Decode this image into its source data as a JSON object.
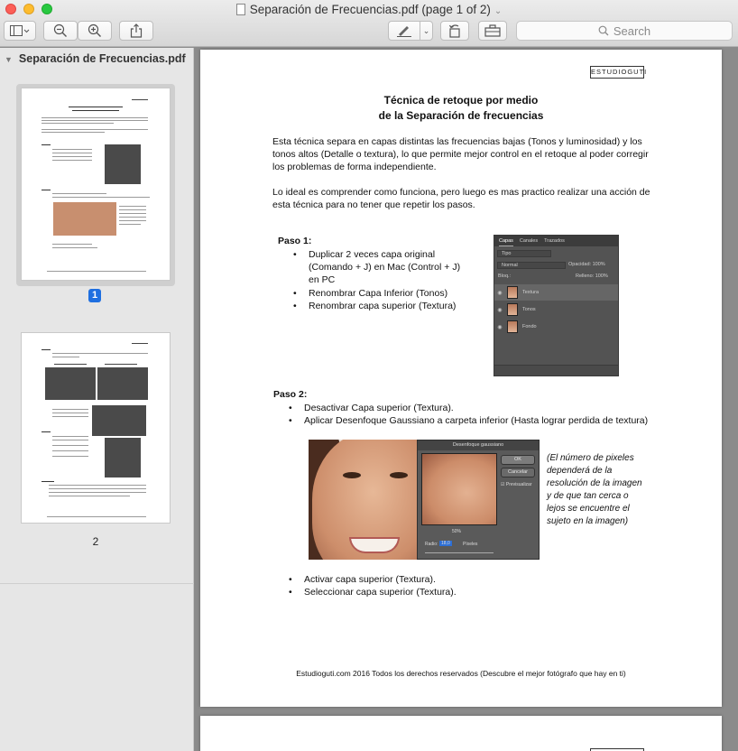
{
  "window": {
    "title": "Separación de Frecuencias.pdf (page 1 of 2)"
  },
  "toolbar": {
    "search_placeholder": "Search"
  },
  "sidebar": {
    "file_name": "Separación de Frecuencias.pdf",
    "pages": [
      {
        "number": "1",
        "selected": true
      },
      {
        "number": "2",
        "selected": false
      }
    ]
  },
  "document": {
    "logo": "ESTUDIOGUTI",
    "title_line1": "Técnica de retoque por medio",
    "title_line2": "de la Separación de frecuencias",
    "intro": "Esta técnica separa en capas distintas las frecuencias bajas (Tonos y luminosidad) y los tonos altos (Detalle o textura), lo que permite mejor control en el retoque al poder corregir los problemas de forma independiente.",
    "ideal": "Lo ideal es comprender como funciona, pero luego es mas practico realizar una acción de esta técnica para no tener que repetir los pasos.",
    "step1": {
      "label": "Paso 1:",
      "items": [
        "Duplicar 2 veces capa original (Comando + J) en Mac (Control + J) en PC",
        "Renombrar Capa Inferior (Tonos)",
        "Renombrar capa superior (Textura)"
      ]
    },
    "layers_panel": {
      "tabs": [
        "Capas",
        "Canales",
        "Trazados"
      ],
      "kind": "Tipo",
      "blend": "Normal",
      "opacity": "Opacidad: 100%",
      "lock": "Bloq.:",
      "fill": "Relleno: 100%",
      "layers": [
        "Textura",
        "Tonos",
        "Fondo"
      ]
    },
    "step2": {
      "label": "Paso 2:",
      "items": [
        "Desactivar Capa superior (Textura).",
        "Aplicar Desenfoque Gaussiano a carpeta inferior (Hasta lograr perdida de textura)"
      ]
    },
    "gauss_dialog": {
      "title": "Desenfoque gaussiano",
      "ok": "OK",
      "cancel": "Cancelar",
      "preview": "Previsualizar",
      "zoom": "50%",
      "radius_label": "Radio:",
      "radius_value": "18,0",
      "radius_unit": "Píxeles"
    },
    "caption": "(El número de pixeles dependerá de la resolución de la imagen y de que tan cerca o lejos se encuentre el sujeto en la imagen)",
    "step3_items": [
      "Activar capa superior (Textura).",
      "Seleccionar capa superior (Textura)."
    ],
    "footer": "Estudioguti.com 2016  Todos los derechos reservados (Descubre el mejor fotógrafo que hay en ti)"
  },
  "colors": {
    "selection_badge": "#1f6fe0",
    "close": "#fc5f57",
    "minimize": "#fdbc2e",
    "maximize": "#28c840"
  }
}
